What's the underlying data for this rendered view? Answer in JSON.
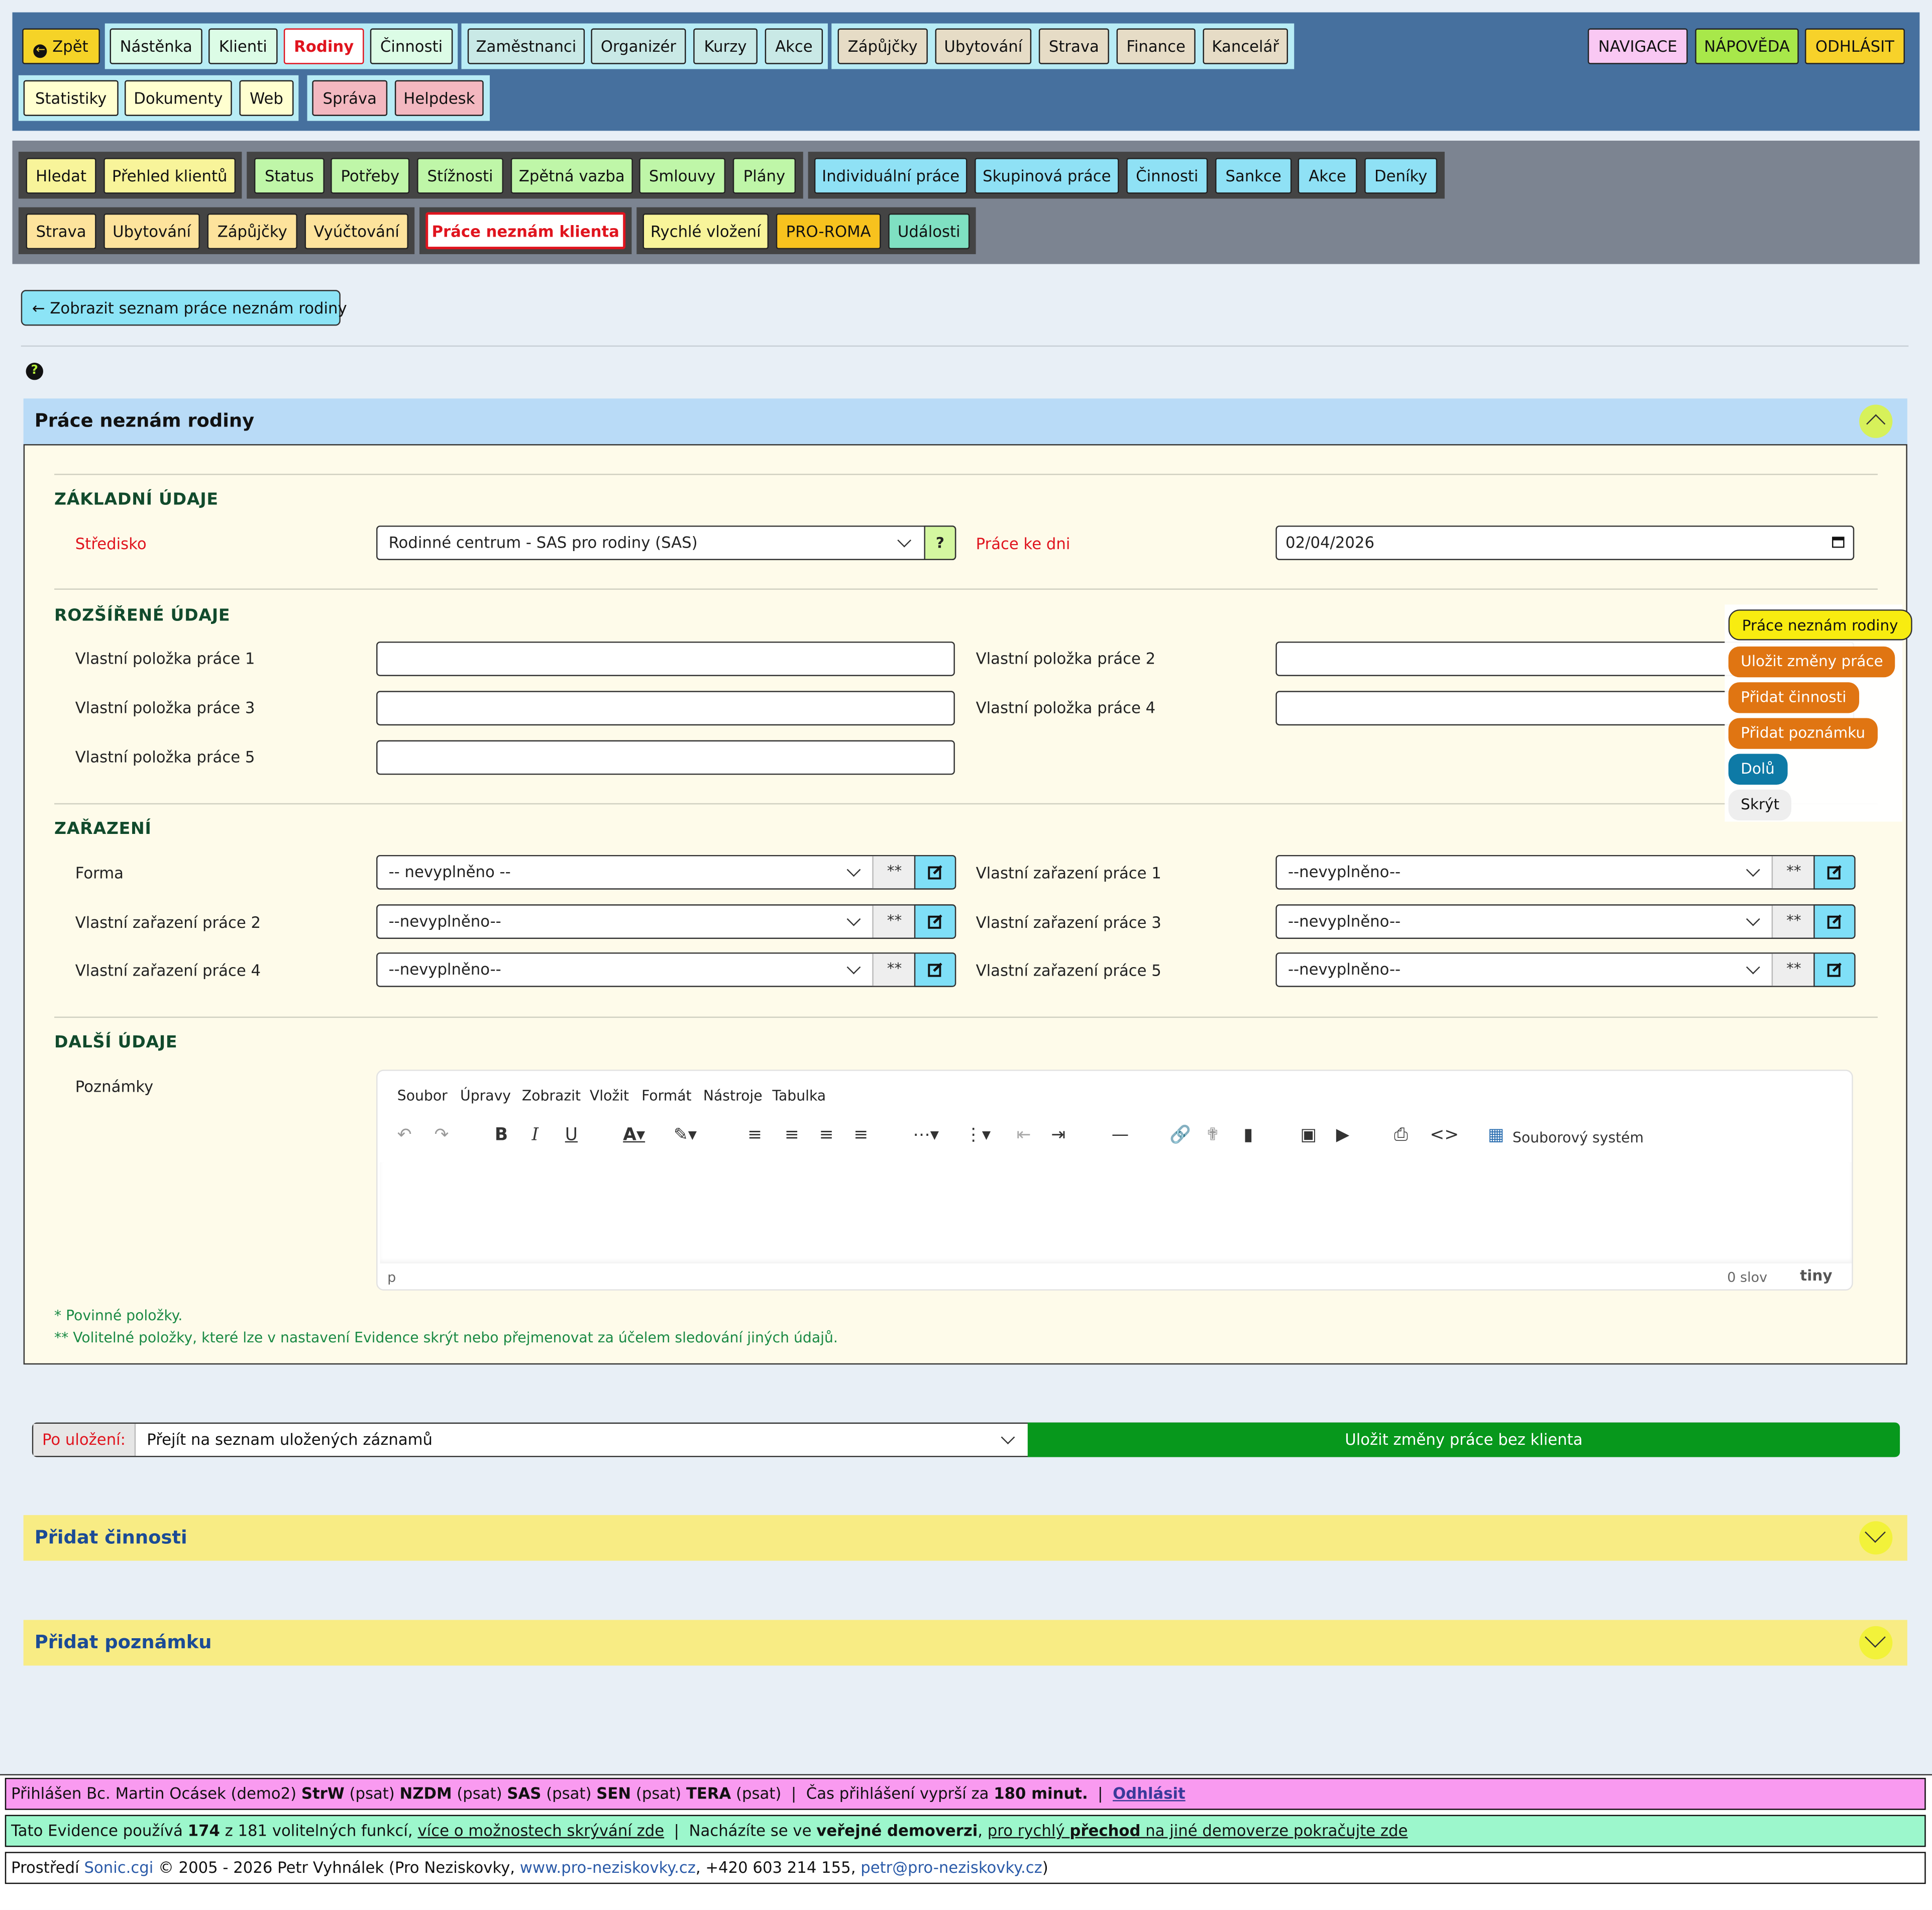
{
  "top_nav": {
    "row1": [
      {
        "label": "Zpět",
        "color": "#f5d327",
        "icon": "arrow-circle-left-icon"
      },
      {
        "label": "Nástěnka",
        "color": "#dcfce6"
      },
      {
        "label": "Klienti",
        "color": "#dcfce6"
      },
      {
        "label": "Rodiny",
        "color": "#ffffff",
        "active": true
      },
      {
        "label": "Činnosti",
        "color": "#dcfce6"
      },
      {
        "label": "Zaměstnanci",
        "color": "#c9e9e6"
      },
      {
        "label": "Organizér",
        "color": "#c9e9e6"
      },
      {
        "label": "Kurzy",
        "color": "#c9e9e6"
      },
      {
        "label": "Akce",
        "color": "#c9e9e6"
      },
      {
        "label": "Zápůjčky",
        "color": "#e6dcc6"
      },
      {
        "label": "Ubytování",
        "color": "#e6dcc6"
      },
      {
        "label": "Strava",
        "color": "#e6dcc6"
      },
      {
        "label": "Finance",
        "color": "#e6dcc6"
      },
      {
        "label": "Kancelář",
        "color": "#e6dcc6"
      }
    ],
    "row2": [
      {
        "label": "Statistiky",
        "color": "#ffffd0"
      },
      {
        "label": "Dokumenty",
        "color": "#ffffd0"
      },
      {
        "label": "Web",
        "color": "#ffffd0"
      },
      {
        "label": "Správa",
        "color": "#f3b8c0"
      },
      {
        "label": "Helpdesk",
        "color": "#f3b8c0"
      }
    ],
    "right": [
      {
        "label": "NAVIGACE",
        "color": "#f9c8f3"
      },
      {
        "label": "NÁPOVĚDA",
        "color": "#a8e84a"
      },
      {
        "label": "ODHLÁSIT",
        "color": "#f7d22a"
      }
    ]
  },
  "sub_nav": {
    "row1": [
      {
        "label": "Hledat",
        "color": "#f8f49a"
      },
      {
        "label": "Přehled klientů",
        "color": "#f8f49a"
      },
      {
        "label": "Status",
        "color": "#bff6a8"
      },
      {
        "label": "Potřeby",
        "color": "#bff6a8"
      },
      {
        "label": "Stížnosti",
        "color": "#bff6a8"
      },
      {
        "label": "Zpětná vazba",
        "color": "#bff6a8"
      },
      {
        "label": "Smlouvy",
        "color": "#bff6a8"
      },
      {
        "label": "Plány",
        "color": "#bff6a8"
      },
      {
        "label": "Individuální práce",
        "color": "#8fe1f5"
      },
      {
        "label": "Skupinová práce",
        "color": "#8fe1f5"
      },
      {
        "label": "Činnosti",
        "color": "#8fe1f5"
      },
      {
        "label": "Sankce",
        "color": "#8fe1f5"
      },
      {
        "label": "Akce",
        "color": "#8fe1f5"
      },
      {
        "label": "Deníky",
        "color": "#8fe1f5"
      }
    ],
    "row2": [
      {
        "label": "Strava",
        "color": "#fde39c"
      },
      {
        "label": "Ubytování",
        "color": "#fde39c"
      },
      {
        "label": "Zápůjčky",
        "color": "#fde39c"
      },
      {
        "label": "Vyúčtování",
        "color": "#fde39c"
      },
      {
        "label": "Práce neznám klienta",
        "color": "#ffffff",
        "active": true
      },
      {
        "label": "Rychlé vložení",
        "color": "#f8f49a"
      },
      {
        "label": "PRO-ROMA",
        "color": "#f7c21e"
      },
      {
        "label": "Události",
        "color": "#7fe0c2"
      }
    ]
  },
  "back_link": {
    "label": "Zobrazit seznam práce neznám rodiny"
  },
  "panel": {
    "title": "Práce neznám rodiny"
  },
  "basic": {
    "heading": "ZÁKLADNÍ ÚDAJE",
    "stredisko_label": "Středisko",
    "stredisko_value": "Rodinné centrum - SAS pro rodiny (SAS)",
    "help_label": "?",
    "date_label": "Práce ke dni",
    "date_value": "02/04/2026"
  },
  "extended": {
    "heading": "ROZŠÍŘENÉ ÚDAJE",
    "items": [
      {
        "label": "Vlastní položka práce 1",
        "value": ""
      },
      {
        "label": "Vlastní položka práce 2",
        "value": ""
      },
      {
        "label": "Vlastní položka práce 3",
        "value": ""
      },
      {
        "label": "Vlastní položka práce 4",
        "value": ""
      },
      {
        "label": "Vlastní položka práce 5",
        "value": ""
      }
    ]
  },
  "classification": {
    "heading": "ZAŘAZENÍ",
    "stars": "**",
    "items": [
      {
        "label": "Forma",
        "value": "-- nevyplněno --"
      },
      {
        "label": "Vlastní zařazení práce 1",
        "value": "--nevyplněno--"
      },
      {
        "label": "Vlastní zařazení práce 2",
        "value": "--nevyplněno--"
      },
      {
        "label": "Vlastní zařazení práce 3",
        "value": "--nevyplněno--"
      },
      {
        "label": "Vlastní zařazení práce 4",
        "value": "--nevyplněno--"
      },
      {
        "label": "Vlastní zařazení práce 5",
        "value": "--nevyplněno--"
      }
    ]
  },
  "other": {
    "heading": "DALŠÍ ÚDAJE",
    "notes_label": "Poznámky",
    "editor": {
      "menu": [
        "Soubor",
        "Úpravy",
        "Zobrazit",
        "Vložit",
        "Formát",
        "Nástroje",
        "Tabulka"
      ],
      "filesystem_label": "Souborový systém",
      "status_path": "p",
      "word_count": "0 slov",
      "brand": "tiny"
    },
    "note_required": "* Povinné položky.",
    "note_optional": "** Volitelné položky, které lze v nastavení Evidence skrýt nebo přejmenovat za účelem sledování jiných údajů."
  },
  "floating_menu": [
    {
      "label": "Práce neznám rodiny",
      "color": "#f8ec10"
    },
    {
      "label": "Uložit změny práce",
      "color": "#e07512"
    },
    {
      "label": "Přidat činnosti",
      "color": "#e07512"
    },
    {
      "label": "Přidat poznámku",
      "color": "#e07512"
    },
    {
      "label": "Dolů",
      "color": "#0e7aa6"
    },
    {
      "label": "Skrýt",
      "color": "#eeeeee"
    }
  ],
  "save_bar": {
    "after_save_label": "Po uložení:",
    "after_save_value": "Přejít na seznam uložených záznamů",
    "save_button": "Uložit změny práce bez klienta"
  },
  "accordions": [
    {
      "title": "Přidat činnosti"
    },
    {
      "title": "Přidat poznámku"
    }
  ],
  "footer": {
    "login": {
      "prefix": "Přihlášen Bc. Martin Ocásek (demo2)",
      "units": [
        {
          "code": "StrW",
          "mode": "(psat)"
        },
        {
          "code": "NZDM",
          "mode": "(psat)"
        },
        {
          "code": "SAS",
          "mode": "(psat)"
        },
        {
          "code": "SEN",
          "mode": "(psat)"
        },
        {
          "code": "TERA",
          "mode": "(psat)"
        }
      ],
      "sep": "|",
      "timeout_text": "Čas přihlášení vyprší za",
      "timeout_value": "180 minut.",
      "logout": "Odhlásit",
      "color": "#f99af0"
    },
    "info": {
      "t1": "Tato Evidence používá",
      "used": "174",
      "t2": "z 181 volitelných funkcí,",
      "link1": "více o možnostech skrývání zde",
      "sep": "|",
      "t3": "Nacházíte se ve",
      "demo": "veřejné demoverzi",
      "t4": "pro rychlý",
      "t5": "přechod",
      "t6": "na jiné demoverze pokračujte zde",
      "color": "#9cf7cc"
    },
    "copyright": {
      "t1": "Prostředí",
      "app": "Sonic.cgi",
      "t2": "© 2005 - 2026 Petr Vyhnálek (Pro Neziskovky,",
      "web": "www.pro-neziskovky.cz",
      "t3": ", +420 603 214 155,",
      "email": "petr@pro-neziskovky.cz",
      "t4": ")"
    }
  }
}
